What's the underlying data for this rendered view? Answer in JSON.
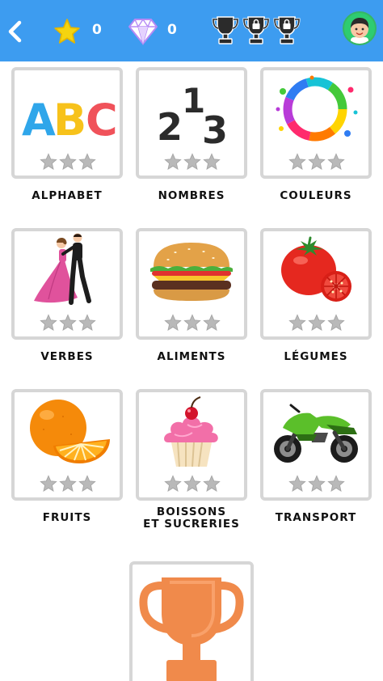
{
  "header": {
    "star_count": "0",
    "gem_count": "0",
    "icons": [
      "back-arrow-icon",
      "star-icon",
      "diamond-icon",
      "trophy-icon",
      "locked-trophy-icon",
      "locked-trophy-icon",
      "avatar"
    ]
  },
  "categories": [
    {
      "label": "ALPHABET",
      "icon": "abc-letters-icon",
      "stars_earned": 0,
      "stars_total": 3
    },
    {
      "label": "NOMBRES",
      "icon": "numbers-123-icon",
      "stars_earned": 0,
      "stars_total": 3
    },
    {
      "label": "COULEURS",
      "icon": "color-splash-icon",
      "stars_earned": 0,
      "stars_total": 3
    },
    {
      "label": "VERBES",
      "icon": "dancers-icon",
      "stars_earned": 0,
      "stars_total": 3
    },
    {
      "label": "ALIMENTS",
      "icon": "burger-icon",
      "stars_earned": 0,
      "stars_total": 3
    },
    {
      "label": "LÉGUMES",
      "icon": "tomato-icon",
      "stars_earned": 0,
      "stars_total": 3
    },
    {
      "label": "FRUITS",
      "icon": "orange-icon",
      "stars_earned": 0,
      "stars_total": 3
    },
    {
      "label_line1": "BOISSONS",
      "label_line2": "ET SUCRERIES",
      "icon": "cupcake-icon",
      "stars_earned": 0,
      "stars_total": 3
    },
    {
      "label": "TRANSPORT",
      "icon": "motorcycle-icon",
      "stars_earned": 0,
      "stars_total": 3
    }
  ],
  "bottom": {
    "icon": "bronze-trophy-icon"
  },
  "colors": {
    "topbar": "#3d9cf0",
    "tile_border": "#d6d6d6",
    "star_empty": "#b9b9b9",
    "star_gold": "#f5d40f",
    "trophy_bronze": "#f08a4b"
  }
}
